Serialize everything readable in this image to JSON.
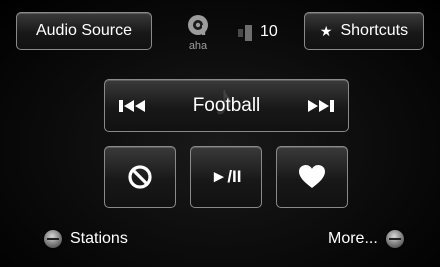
{
  "header": {
    "audio_source_label": "Audio Source",
    "logo_text": "aha",
    "volume_level": "10",
    "shortcuts_label": "Shortcuts",
    "shortcuts_icon": "★"
  },
  "player": {
    "track_title": "Football",
    "controls": [
      "ban-icon",
      "play-pause-icon",
      "heart-icon"
    ],
    "play_pause_label": "►/II"
  },
  "footer": {
    "stations_label": "Stations",
    "more_label": "More..."
  }
}
